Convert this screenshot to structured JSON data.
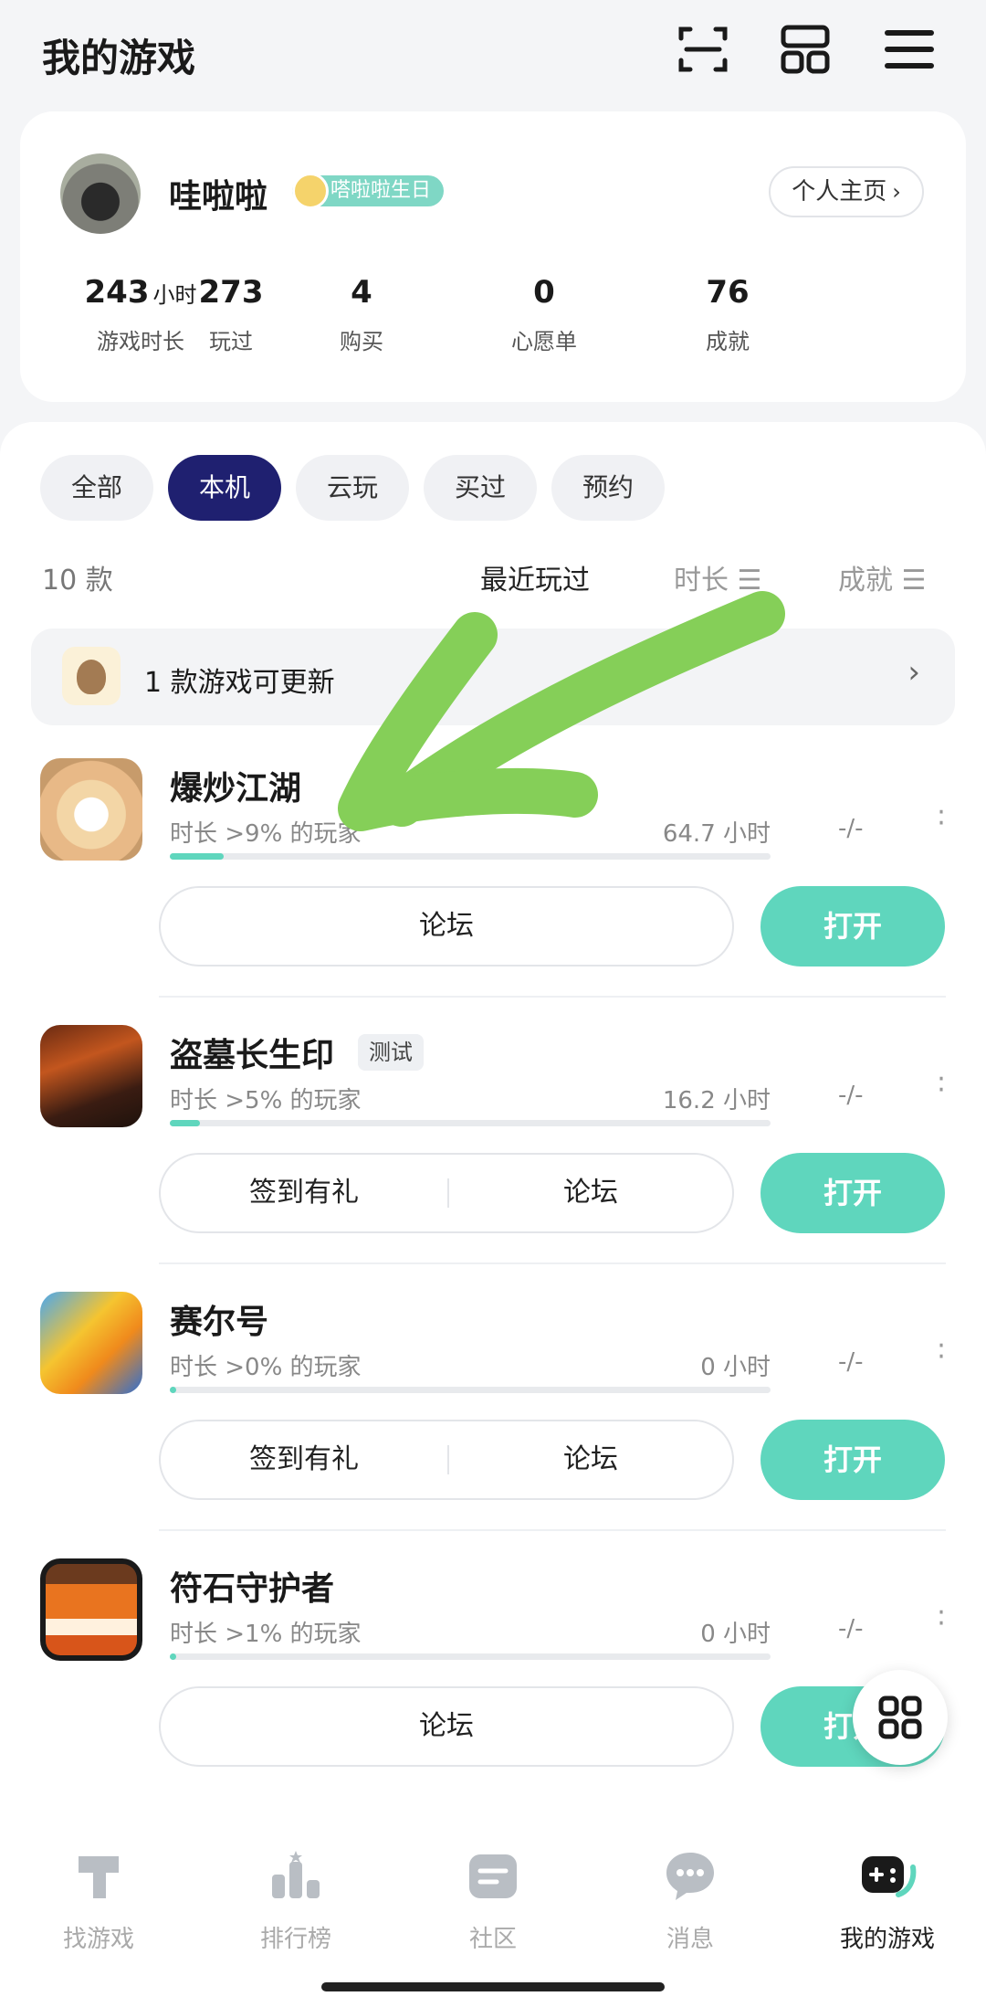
{
  "header": {
    "title": "我的游戏",
    "icons": [
      "scan-icon",
      "grid-view-icon",
      "menu-icon"
    ]
  },
  "profile": {
    "name": "哇啦啦",
    "badge": "嗒啦啦生日",
    "home_button": "个人主页",
    "stats": [
      {
        "value": "243",
        "unit": "小时",
        "label": "游戏时长"
      },
      {
        "value": "273",
        "unit": "",
        "label": "玩过"
      },
      {
        "value": "4",
        "unit": "",
        "label": "购买"
      },
      {
        "value": "0",
        "unit": "",
        "label": "心愿单"
      },
      {
        "value": "76",
        "unit": "",
        "label": "成就"
      }
    ]
  },
  "filters": [
    {
      "label": "全部",
      "active": false
    },
    {
      "label": "本机",
      "active": true
    },
    {
      "label": "云玩",
      "active": false
    },
    {
      "label": "买过",
      "active": false
    },
    {
      "label": "预约",
      "active": false
    }
  ],
  "list": {
    "count": "10 款",
    "sort": {
      "recent": "最近玩过",
      "duration": "时长 ☰",
      "achievement": "成就 ☰"
    },
    "update_banner": "1 款游戏可更新"
  },
  "games": [
    {
      "name": "爆炒江湖",
      "tag": "",
      "meta": "时长 >9% 的玩家",
      "hours": "64.7 小时",
      "achievement": "-/-",
      "progress": 0.09,
      "actions": [
        "论坛"
      ],
      "open": "打开"
    },
    {
      "name": "盗墓长生印",
      "tag": "测试",
      "meta": "时长 >5% 的玩家",
      "hours": "16.2 小时",
      "achievement": "-/-",
      "progress": 0.05,
      "actions": [
        "签到有礼",
        "论坛"
      ],
      "open": "打开"
    },
    {
      "name": "赛尔号",
      "tag": "",
      "meta": "时长 >0% 的玩家",
      "hours": "0 小时",
      "achievement": "-/-",
      "progress": 0.0,
      "actions": [
        "签到有礼",
        "论坛"
      ],
      "open": "打开"
    },
    {
      "name": "符石守护者",
      "tag": "",
      "meta": "时长 >1% 的玩家",
      "hours": "0 小时",
      "achievement": "-/-",
      "progress": 0.01,
      "actions": [
        "论坛"
      ],
      "open": "打开"
    }
  ],
  "nav": [
    {
      "label": "找游戏",
      "active": false
    },
    {
      "label": "排行榜",
      "active": false
    },
    {
      "label": "社区",
      "active": false
    },
    {
      "label": "消息",
      "active": false
    },
    {
      "label": "我的游戏",
      "active": true
    }
  ],
  "colors": {
    "accent": "#5fd6bd",
    "chip_active": "#1f2070",
    "arrow": "#85cf58"
  }
}
